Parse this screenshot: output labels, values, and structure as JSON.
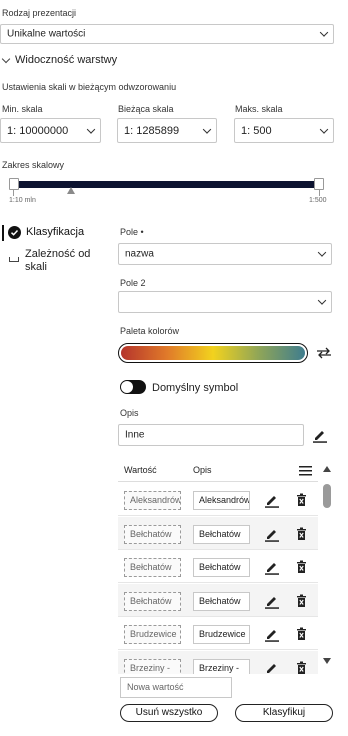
{
  "presentation": {
    "label": "Rodzaj prezentacji",
    "value": "Unikalne wartości"
  },
  "visibility": {
    "header": "Widoczność warstwy",
    "subtitle": "Ustawienia skali w bieżącym odwzorowaniu",
    "min": {
      "label": "Min. skala",
      "prefix": "1:",
      "value": "10000000"
    },
    "current": {
      "label": "Bieżąca skala",
      "prefix": "1:",
      "value": "1285899"
    },
    "max": {
      "label": "Maks. skala",
      "prefix": "1:",
      "value": "500"
    },
    "range_label": "Zakres skalowy",
    "range_min": "1:10 mln",
    "range_max": "1:500"
  },
  "nav": {
    "classification": "Klasyfikacja",
    "scale_dependence": "Zależność od skali"
  },
  "fields": {
    "field1_label": "Pole •",
    "field1_value": "nazwa",
    "field2_label": "Pole 2",
    "field2_value": "",
    "palette_label": "Paleta kolorów"
  },
  "default_symbol": {
    "label": "Domyślny symbol",
    "enabled": true
  },
  "description": {
    "label": "Opis",
    "value": "Inne"
  },
  "table": {
    "col_value": "Wartość",
    "col_desc": "Opis",
    "rows": [
      {
        "value": "Aleksandrów",
        "desc": "Aleksandrów"
      },
      {
        "value": "Bełchatów",
        "desc": "Bełchatów"
      },
      {
        "value": "Bełchatów",
        "desc": "Bełchatów"
      },
      {
        "value": "Bełchatów",
        "desc": "Bełchatów"
      },
      {
        "value": "Brudzewice",
        "desc": "Brudzewice"
      },
      {
        "value": "Brzeziny - ",
        "desc": "Brzeziny - "
      }
    ]
  },
  "new_value_placeholder": "Nowa wartość",
  "buttons": {
    "remove_all": "Usuń wszystko",
    "classify": "Klasyfikuj"
  },
  "colors": {
    "accent": "#111111",
    "palette_stops": [
      "#b5342c",
      "#e07a2a",
      "#f2d21e",
      "#8fa558",
      "#3f7d8e"
    ]
  }
}
